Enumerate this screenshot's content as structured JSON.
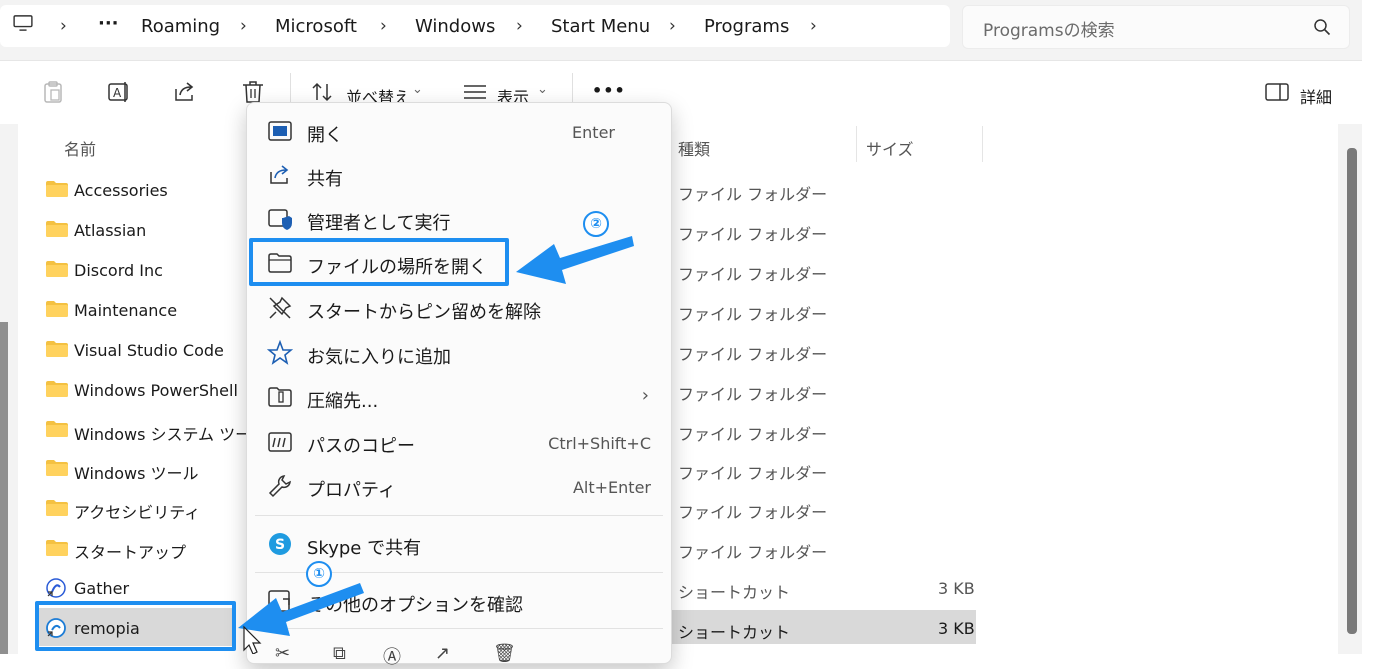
{
  "breadcrumb": {
    "items": [
      "Roaming",
      "Microsoft",
      "Windows",
      "Start Menu",
      "Programs"
    ]
  },
  "search": {
    "placeholder": "Programsの検索"
  },
  "toolbar": {
    "sort_label": "並べ替え",
    "view_label": "表示",
    "more_label": "•••",
    "details_label": "詳細"
  },
  "columns": {
    "name": "名前",
    "type": "種類",
    "size": "サイズ"
  },
  "files": [
    {
      "name": "Accessories",
      "type": "ファイル フォルダー",
      "size": "",
      "icon": "folder-icon"
    },
    {
      "name": "Atlassian",
      "type": "ファイル フォルダー",
      "size": "",
      "icon": "folder-icon"
    },
    {
      "name": "Discord Inc",
      "type": "ファイル フォルダー",
      "size": "",
      "icon": "folder-icon"
    },
    {
      "name": "Maintenance",
      "type": "ファイル フォルダー",
      "size": "",
      "icon": "folder-icon"
    },
    {
      "name": "Visual Studio Code",
      "type": "ファイル フォルダー",
      "size": "",
      "icon": "folder-icon"
    },
    {
      "name": "Windows PowerShell",
      "type": "ファイル フォルダー",
      "size": "",
      "icon": "folder-icon"
    },
    {
      "name": "Windows システム ツール",
      "type": "ファイル フォルダー",
      "size": "",
      "icon": "folder-icon"
    },
    {
      "name": "Windows ツール",
      "type": "ファイル フォルダー",
      "size": "",
      "icon": "folder-icon"
    },
    {
      "name": "アクセシビリティ",
      "type": "ファイル フォルダー",
      "size": "",
      "icon": "folder-icon"
    },
    {
      "name": "スタートアップ",
      "type": "ファイル フォルダー",
      "size": "",
      "icon": "folder-icon"
    },
    {
      "name": "Gather",
      "type": "ショートカット",
      "size": "3 KB",
      "icon": "gather-shortcut-icon"
    },
    {
      "name": "remopia",
      "type": "ショートカット",
      "size": "3 KB",
      "icon": "remopia-shortcut-icon",
      "selected": true
    }
  ],
  "context_menu": {
    "items": [
      {
        "label": "開く",
        "shortcut": "Enter",
        "icon": "open-icon"
      },
      {
        "label": "共有",
        "shortcut": "",
        "icon": "share-icon"
      },
      {
        "label": "管理者として実行",
        "shortcut": "",
        "icon": "run-as-admin-icon"
      },
      {
        "label": "ファイルの場所を開く",
        "shortcut": "",
        "icon": "folder-open-icon"
      },
      {
        "label": "スタートからピン留めを解除",
        "shortcut": "",
        "icon": "unpin-icon"
      },
      {
        "label": "お気に入りに追加",
        "shortcut": "",
        "icon": "star-icon"
      },
      {
        "label": "圧縮先...",
        "shortcut": "",
        "icon": "zip-icon",
        "submenu": true
      },
      {
        "label": "パスのコピー",
        "shortcut": "Ctrl+Shift+C",
        "icon": "copy-path-icon"
      },
      {
        "label": "プロパティ",
        "shortcut": "Alt+Enter",
        "icon": "wrench-icon"
      },
      {
        "label": "Skype で共有",
        "shortcut": "",
        "icon": "skype-icon"
      },
      {
        "label": "その他のオプションを確認",
        "shortcut": "",
        "icon": "more-options-icon"
      }
    ]
  },
  "annotations": {
    "step1": "①",
    "step2": "②"
  },
  "colors": {
    "accent": "#1e8ef0",
    "folder": "#f4c142",
    "selection": "#d9d9d9"
  }
}
